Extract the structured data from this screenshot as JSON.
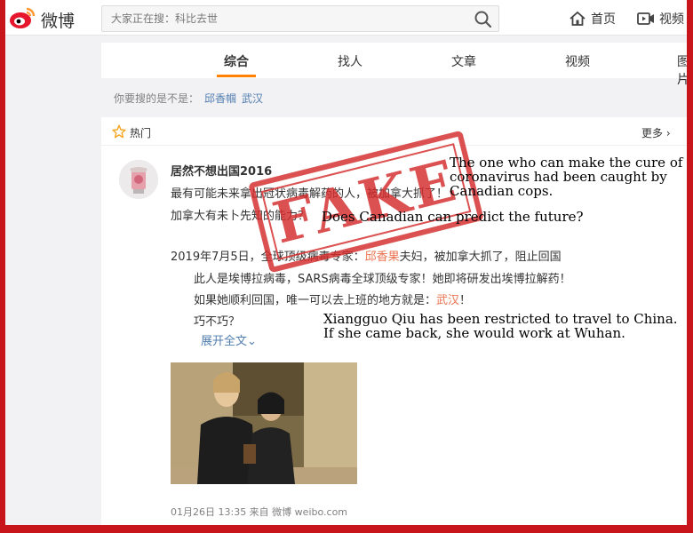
{
  "topbar": {
    "logo_text": "微博",
    "search_placeholder": "大家正在搜：科比去世",
    "nav_home": "首页",
    "nav_video": "视频"
  },
  "tabs": [
    "综合",
    "找人",
    "文章",
    "视频",
    "图片"
  ],
  "suggest": {
    "label": "你要搜的是不是：",
    "keywords": [
      "邱香帼",
      "武汉"
    ]
  },
  "hot": {
    "title": "热门",
    "more": "更多"
  },
  "post": {
    "username": "居然不想出国2016",
    "line1": "最有可能未来拿出冠状病毒解药的人，被加拿大抓了！",
    "line2": "加拿大有未卜先知的能力？",
    "line3_a": "2019年7月5日，全球顶级病毒专家：",
    "line3_name": "邱香果",
    "line3_b": "夫妇，被加拿大抓了，阻止回国",
    "line4": "此人是埃博拉病毒，SARS病毒全球顶级专家！她即将研发出埃博拉解药！",
    "line5_a": "如果她顺利回国，唯一可以去上班的地方就是：",
    "line5_link": "武汉",
    "line5_b": "！",
    "line6": "巧不巧？",
    "expand": "展开全文",
    "meta": "01月26日 13:35  来自 微博 weibo.com"
  },
  "annotations": {
    "stamp": "FAKE",
    "note1_l1": "The one who can make the cure of",
    "note1_l2": "coronavirus had been caught by",
    "note1_l3": "Canadian cops.",
    "note2": "Does Canadian can predict the future?",
    "note3_l1": "Xiangguo Qiu has been restricted to travel to China.",
    "note3_l2": "If she came back, she would work at Wuhan."
  },
  "colors": {
    "border_red": "#c8151b",
    "accent_orange": "#ff8200",
    "link_blue": "#507daf",
    "highlight_red": "#eb7350"
  }
}
